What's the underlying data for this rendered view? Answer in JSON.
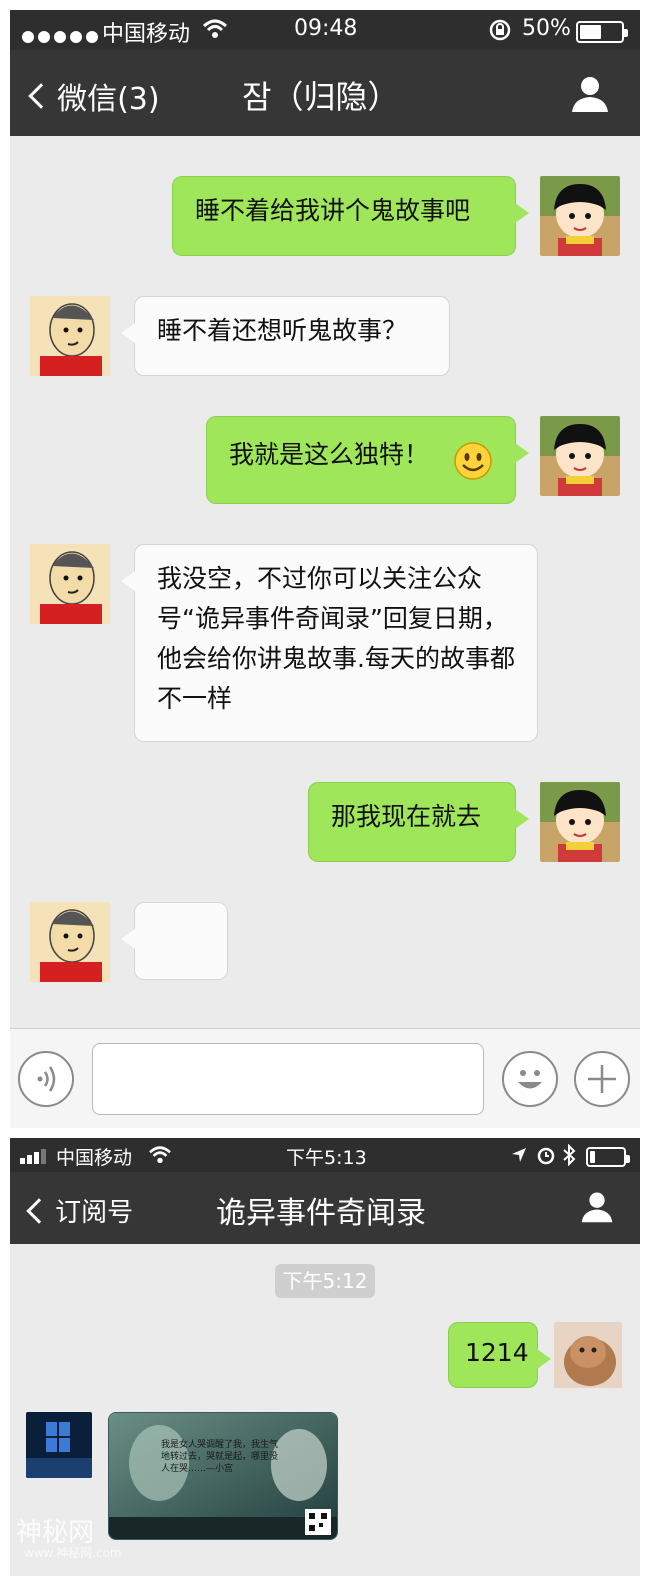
{
  "screen1": {
    "status": {
      "carrier": "中国移动",
      "time": "09:48",
      "battery_percent": "50%",
      "battery_level": 0.5
    },
    "nav": {
      "back_label": "微信(3)",
      "title": "잠（归隐）"
    },
    "messages": [
      {
        "from": "me",
        "text": "睡不着给我讲个鬼故事吧"
      },
      {
        "from": "other",
        "text": "睡不着还想听鬼故事？"
      },
      {
        "from": "me",
        "text": "我就是这么独特！",
        "emoji": "smiley-emoji"
      },
      {
        "from": "other",
        "text": "我没空，不过你可以关注公众号“诡异事件奇闻录”回复日期，他会给你讲鬼故事.每天的故事都不一样"
      },
      {
        "from": "me",
        "text": "那我现在就去"
      },
      {
        "from": "other",
        "text": ""
      }
    ],
    "input": {
      "placeholder": ""
    }
  },
  "screen2": {
    "status": {
      "carrier": "中国移动",
      "time": "下午5:13",
      "battery_level": 0.15
    },
    "nav": {
      "back_label": "订阅号",
      "title": "诡异事件奇闻录"
    },
    "timestamp": "下午5:12",
    "messages": [
      {
        "from": "me",
        "text": "1214"
      },
      {
        "from": "other",
        "type": "image",
        "image_text": "我是女人哭调醒了我，我生气地转过去，哭就是起，哪里没人在哭……—小宫"
      }
    ]
  },
  "watermark": {
    "text": "神秘网",
    "sub": "www.神秘网.com"
  },
  "colors": {
    "me_bubble": "#9fe65b",
    "other_bubble": "#fbfbfb",
    "navbar": "#363636",
    "chat_bg": "#ebebeb"
  }
}
